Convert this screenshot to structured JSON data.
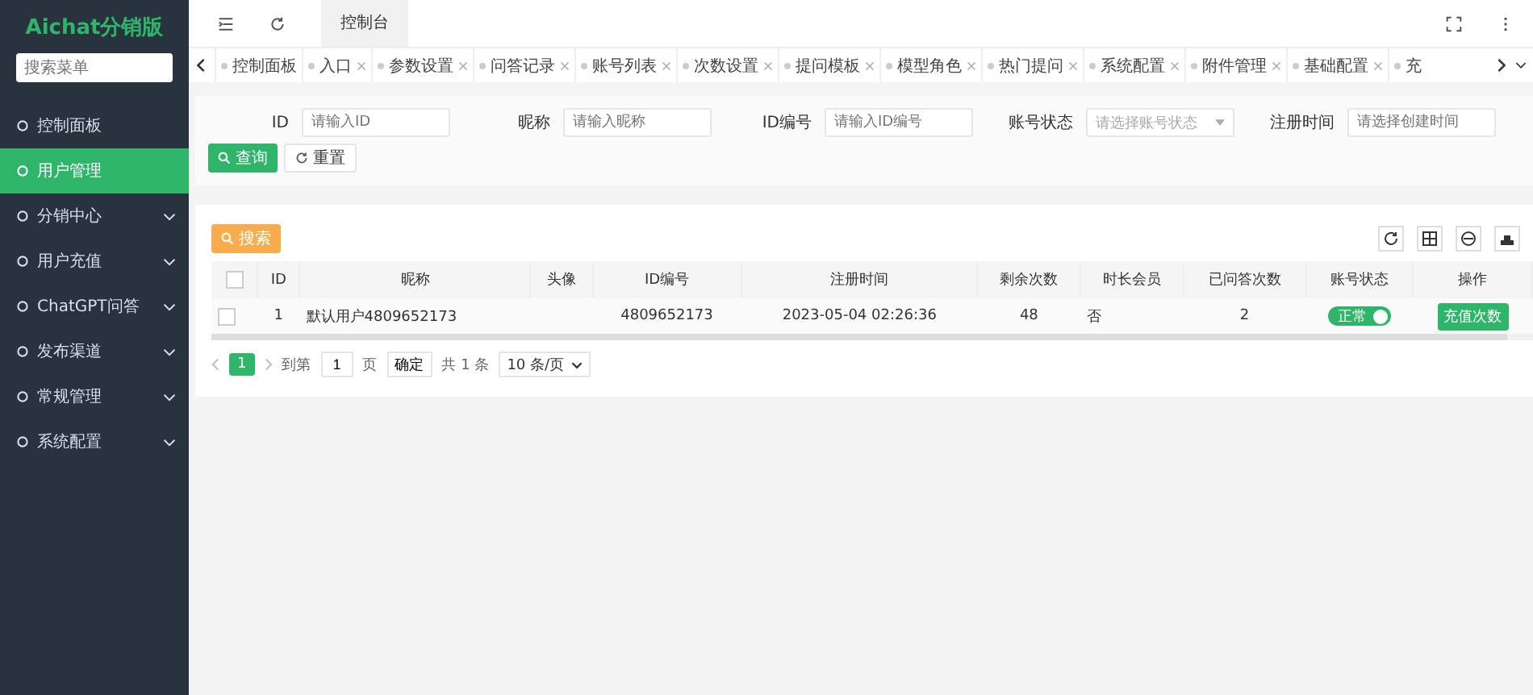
{
  "sidebar": {
    "title": "Aichat分销版",
    "search": {
      "placeholder": "搜索菜单"
    },
    "items": [
      {
        "label": "控制面板",
        "kind": "link",
        "selected": false
      },
      {
        "label": "用户管理",
        "kind": "link",
        "selected": true
      },
      {
        "label": "分销中心",
        "kind": "group",
        "selected": false
      },
      {
        "label": "用户充值",
        "kind": "group",
        "selected": false
      },
      {
        "label": "ChatGPT问答",
        "kind": "group",
        "selected": false
      },
      {
        "label": "发布渠道",
        "kind": "group",
        "selected": false
      },
      {
        "label": "常规管理",
        "kind": "group",
        "selected": false
      },
      {
        "label": "系统配置",
        "kind": "group",
        "selected": false
      }
    ]
  },
  "header": {
    "page_tab": {
      "label": "控制台",
      "selected": true
    }
  },
  "tabs": [
    {
      "label": "控制面板",
      "closable": false,
      "selected": false
    },
    {
      "label": "入口",
      "closable": true,
      "selected": false
    },
    {
      "label": "参数设置",
      "closable": true,
      "selected": false
    },
    {
      "label": "问答记录",
      "closable": true,
      "selected": false
    },
    {
      "label": "账号列表",
      "closable": true,
      "selected": false
    },
    {
      "label": "次数设置",
      "closable": true,
      "selected": false
    },
    {
      "label": "提问模板",
      "closable": true,
      "selected": false
    },
    {
      "label": "模型角色",
      "closable": true,
      "selected": false
    },
    {
      "label": "热门提问",
      "closable": true,
      "selected": false
    },
    {
      "label": "系统配置",
      "closable": true,
      "selected": false
    },
    {
      "label": "附件管理",
      "closable": true,
      "selected": false
    },
    {
      "label": "基础配置",
      "closable": true,
      "selected": false
    },
    {
      "label": "充",
      "closable": false,
      "selected": false
    }
  ],
  "filters": {
    "fields": [
      {
        "label": "ID",
        "placeholder": "请输入ID",
        "kind": "text"
      },
      {
        "label": "昵称",
        "placeholder": "请输入昵称",
        "kind": "text"
      },
      {
        "label": "ID编号",
        "placeholder": "请输入ID编号",
        "kind": "text"
      },
      {
        "label": "账号状态",
        "placeholder": "请选择账号状态",
        "kind": "select"
      },
      {
        "label": "注册时间",
        "placeholder": "请选择创建时间",
        "kind": "text"
      }
    ],
    "query_button": "查询",
    "reset_button": "重置"
  },
  "table": {
    "search_button": "搜索",
    "all_checked": false,
    "columns": [
      "ID",
      "昵称",
      "头像",
      "ID编号",
      "注册时间",
      "剩余次数",
      "时长会员",
      "已问答次数",
      "账号状态",
      "操作"
    ],
    "rows": [
      {
        "checked": false,
        "cells": [
          "1",
          "默认用户4809652173",
          "",
          "4809652173",
          "2023-05-04 02:26:36",
          "48",
          "否",
          "2"
        ],
        "status": {
          "label": "正常",
          "on": true
        },
        "action": "充值次数"
      }
    ]
  },
  "pagination": {
    "pages": [
      {
        "label": "1",
        "selected": true
      }
    ],
    "goto_label": "到第",
    "goto_value": "1",
    "page_unit": "页",
    "confirm": "确定",
    "total": "共 1 条",
    "page_size": "10 条/页"
  }
}
